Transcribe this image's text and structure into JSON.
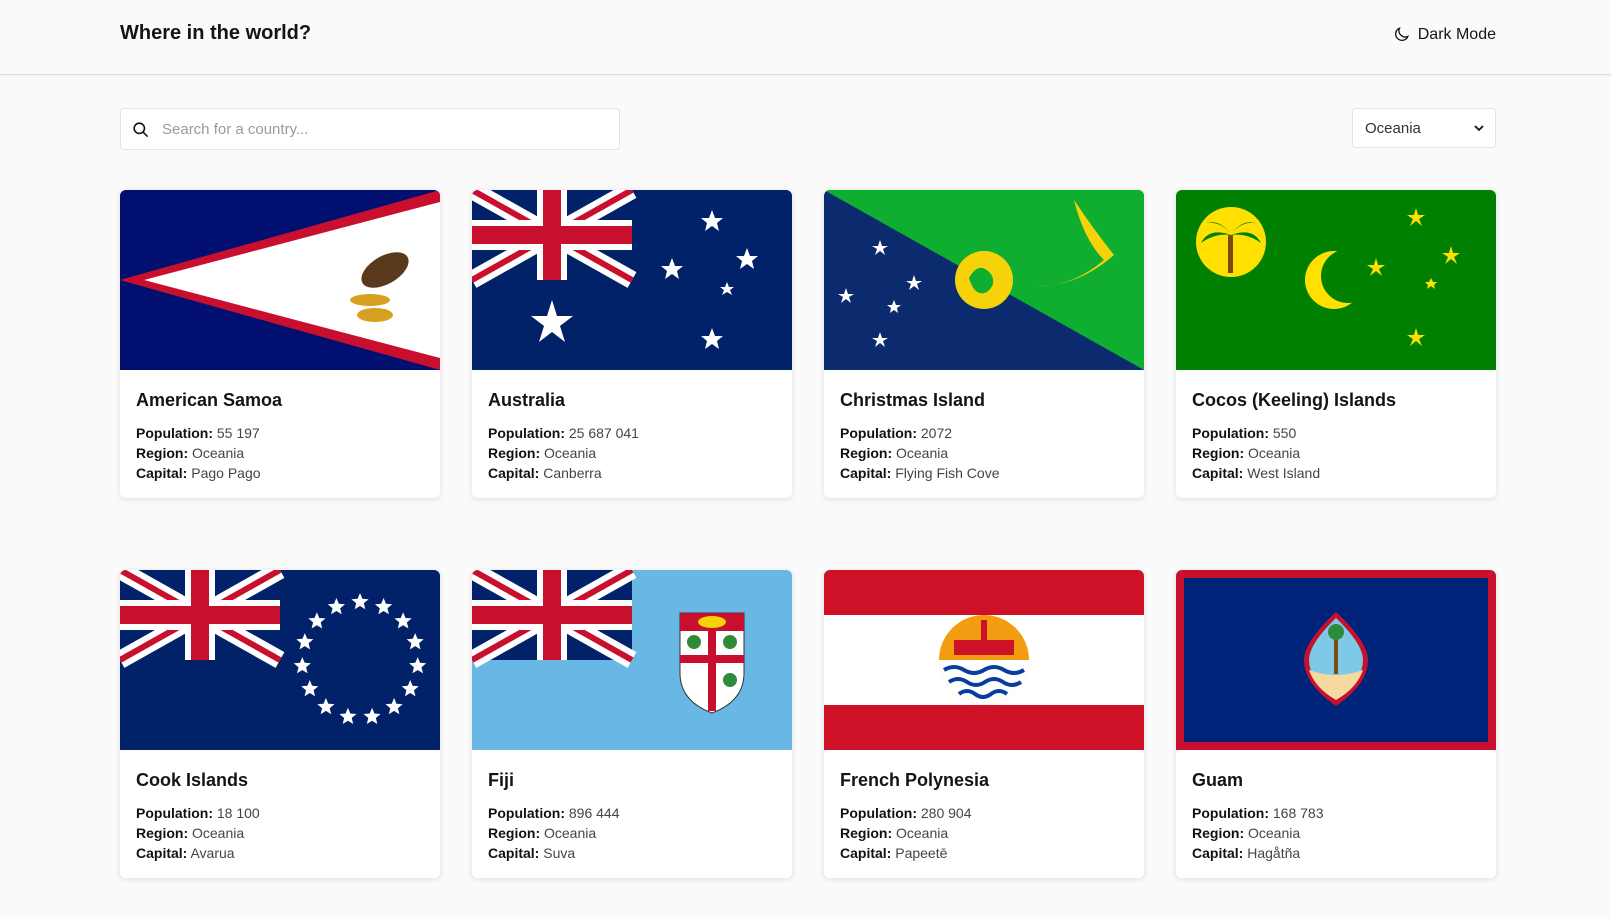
{
  "header": {
    "title": "Where in the world?",
    "dark_mode_label": "Dark Mode"
  },
  "search": {
    "placeholder": "Search for a country...",
    "value": ""
  },
  "filter": {
    "selected": "Oceania"
  },
  "labels": {
    "population": "Population:",
    "region": "Region:",
    "capital": "Capital:"
  },
  "countries": [
    {
      "name": "American Samoa",
      "population": "55 197",
      "region": "Oceania",
      "capital": "Pago Pago"
    },
    {
      "name": "Australia",
      "population": "25 687 041",
      "region": "Oceania",
      "capital": "Canberra"
    },
    {
      "name": "Christmas Island",
      "population": "2072",
      "region": "Oceania",
      "capital": "Flying Fish Cove"
    },
    {
      "name": "Cocos (Keeling) Islands",
      "population": "550",
      "region": "Oceania",
      "capital": "West Island"
    },
    {
      "name": "Cook Islands",
      "population": "18 100",
      "region": "Oceania",
      "capital": "Avarua"
    },
    {
      "name": "Fiji",
      "population": "896 444",
      "region": "Oceania",
      "capital": "Suva"
    },
    {
      "name": "French Polynesia",
      "population": "280 904",
      "region": "Oceania",
      "capital": "Papeetē"
    },
    {
      "name": "Guam",
      "population": "168 783",
      "region": "Oceania",
      "capital": "Hagåtña"
    }
  ],
  "icons": {
    "dark_mode": "moon-icon",
    "search": "search-icon",
    "select": "chevron-down-icon"
  },
  "colors": {
    "background": "#fafafa",
    "card": "#ffffff",
    "text": "#111517"
  }
}
